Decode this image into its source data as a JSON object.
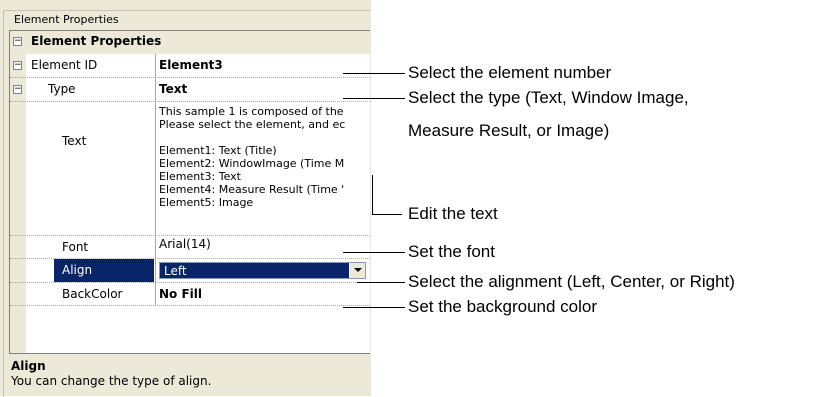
{
  "group_title": "Element Properties",
  "category_title": "Element Properties",
  "rows": {
    "element_id": {
      "label": "Element ID",
      "value": "Element3"
    },
    "type": {
      "label": "Type",
      "value": "Text"
    },
    "text": {
      "label": "Text",
      "lines": [
        "This sample 1 is composed of the",
        "Please select the element, and ec",
        "",
        "Element1: Text (Title)",
        "Element2: WindowImage (Time M",
        "Element3: Text",
        "Element4: Measure Result (Time '",
        "Element5: Image"
      ]
    },
    "font": {
      "label": "Font",
      "value": "Arial(14)"
    },
    "align": {
      "label": "Align",
      "value": "Left"
    },
    "backcolor": {
      "label": "BackColor",
      "value": "No Fill"
    }
  },
  "help": {
    "title": "Align",
    "description": "You can change the type of align."
  },
  "callouts": [
    "Select the element number",
    "Select the type (Text, Window Image,",
    "Measure Result, or Image)",
    "Edit the text",
    "Set the font",
    "Select the alignment (Left, Center, or Right)",
    "Set the background color"
  ],
  "icons": {
    "collapse": "minus-box-icon",
    "dropdown": "chevron-down-icon"
  },
  "colors": {
    "panel_bg": "#ece9d8",
    "selection": "#0a246a"
  }
}
